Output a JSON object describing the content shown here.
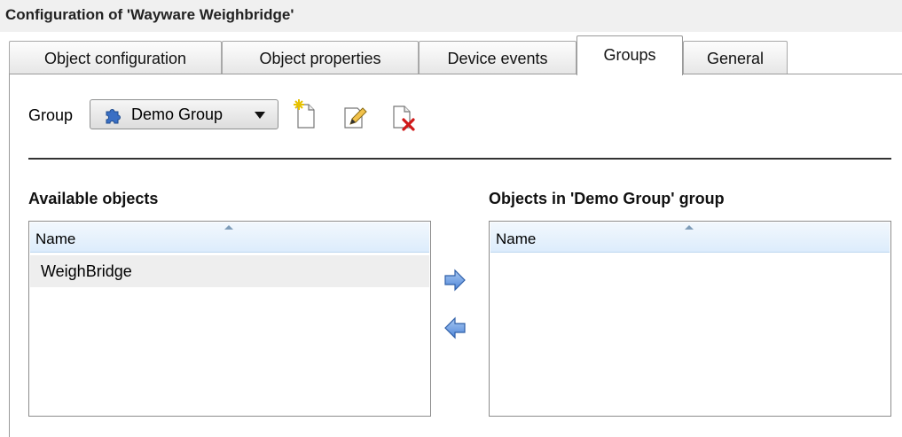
{
  "window": {
    "title": "Configuration of 'Wayware Weighbridge'"
  },
  "tabs": [
    {
      "label": "Object configuration",
      "active": false
    },
    {
      "label": "Object properties",
      "active": false
    },
    {
      "label": "Device events",
      "active": false
    },
    {
      "label": "Groups",
      "active": true
    },
    {
      "label": "General",
      "active": false
    }
  ],
  "group": {
    "label": "Group",
    "selected": "Demo Group",
    "icon": "puzzle-piece-icon",
    "tools": [
      "new-document-icon",
      "edit-pencil-icon",
      "delete-document-icon"
    ]
  },
  "available": {
    "title": "Available objects",
    "column": "Name",
    "rows": [
      "WeighBridge"
    ]
  },
  "in_group": {
    "title": "Objects in 'Demo Group' group",
    "column": "Name",
    "rows": []
  },
  "colors": {
    "accent": "#4f86d9",
    "header_bg": "#dcecfc",
    "row_bg": "#eeeeee"
  }
}
